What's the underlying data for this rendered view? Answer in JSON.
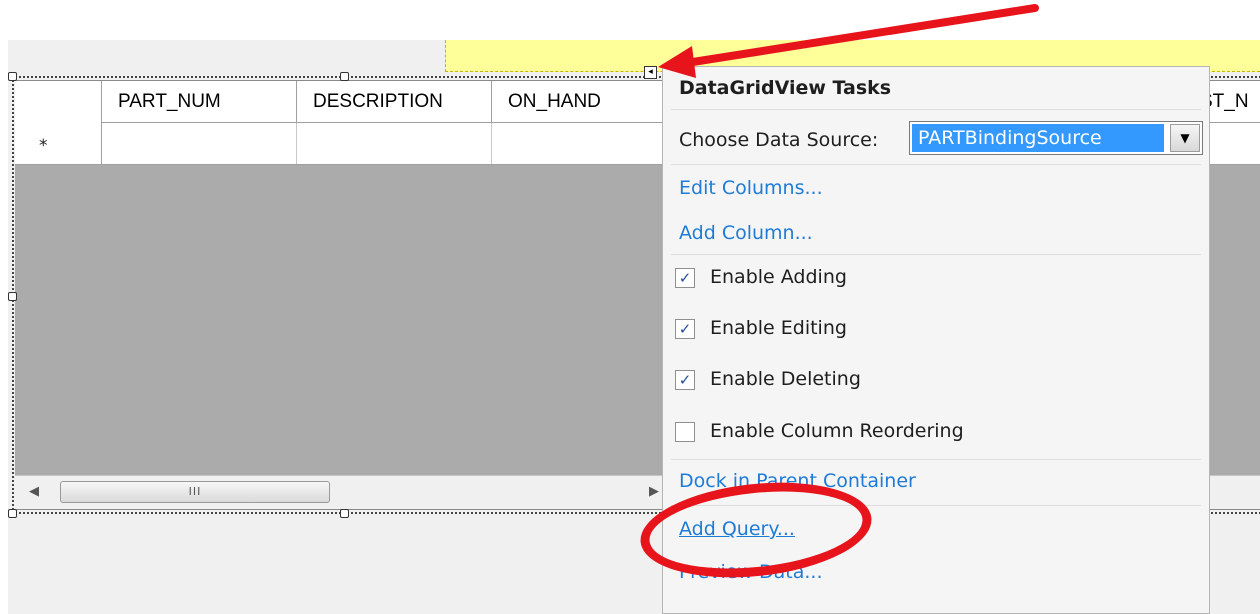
{
  "grid": {
    "columns": [
      "PART_NUM",
      "DESCRIPTION",
      "ON_HAND"
    ],
    "partial_column": "ST_N",
    "new_row_marker": "*",
    "scroll_thumb_grip": "III"
  },
  "smart_tag": {
    "glyph": "◂"
  },
  "tasks_panel": {
    "title": "DataGridView Tasks",
    "data_source_label": "Choose Data Source:",
    "data_source_value": "PARTBindingSource",
    "links": {
      "edit_columns": "Edit Columns...",
      "add_column": "Add Column...",
      "dock_in_parent": "Dock in Parent Container",
      "add_query": "Add Query...",
      "preview_data": "Preview Data..."
    },
    "checkboxes": [
      {
        "label": "Enable Adding",
        "checked": true
      },
      {
        "label": "Enable Editing",
        "checked": true
      },
      {
        "label": "Enable Deleting",
        "checked": true
      },
      {
        "label": "Enable Column Reordering",
        "checked": false
      }
    ]
  },
  "annotation": {
    "color": "#e8141c"
  },
  "colors": {
    "link": "#1e7bd6",
    "selection": "#3399ff",
    "grid_background": "#ababab",
    "highlight_band": "#ffff99"
  }
}
